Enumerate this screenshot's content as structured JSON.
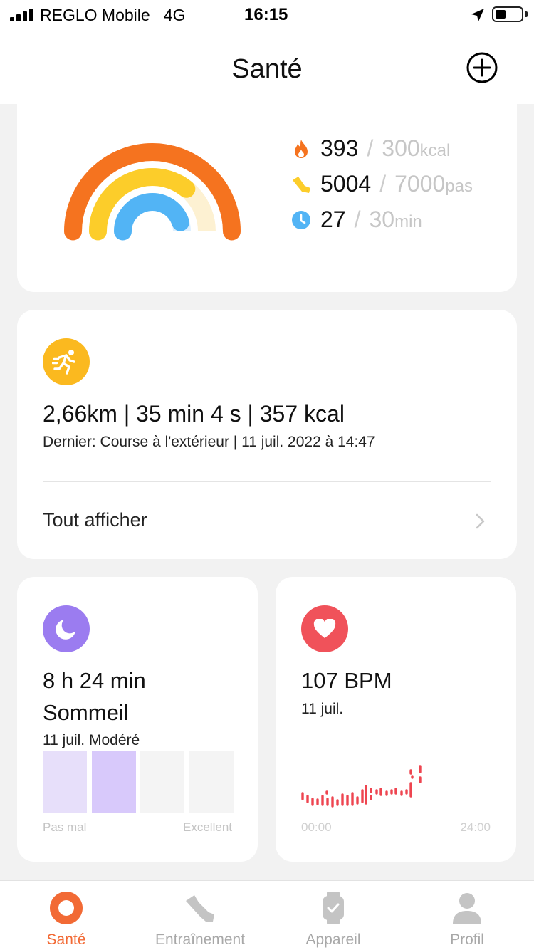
{
  "status_bar": {
    "carrier": "REGLO Mobile",
    "network": "4G",
    "time": "16:15"
  },
  "header": {
    "title": "Santé",
    "add_icon": "plus-circle-icon"
  },
  "activity": {
    "stats": [
      {
        "icon": "flame-icon",
        "value": "393",
        "goal": "300",
        "unit": "kcal",
        "color": "#f5731f",
        "progress": 1.31
      },
      {
        "icon": "steps-icon",
        "value": "5004",
        "goal": "7000",
        "unit": "pas",
        "color": "#fccd2a",
        "progress": 0.715
      },
      {
        "icon": "clock-icon",
        "value": "27",
        "goal": "30",
        "unit": "min",
        "color": "#52b4f5",
        "progress": 0.9
      }
    ]
  },
  "workout": {
    "icon": "running-icon",
    "summary": "2,66km | 35 min 4 s | 357 kcal",
    "last": "Dernier: Course à l'extérieur | 11 juil. 2022 à 14:47",
    "view_all": "Tout afficher"
  },
  "sleep": {
    "icon": "moon-icon",
    "duration": "8 h 24 min",
    "label": "Sommeil",
    "date": "11 juil.",
    "quality": "Modéré",
    "scale_min": "Pas mal",
    "scale_max": "Excellent",
    "quality_level": 2,
    "levels": 4
  },
  "heart": {
    "icon": "heart-icon",
    "bpm": "107 BPM",
    "date": "11 juil.",
    "x_start": "00:00",
    "x_end": "24:00",
    "color": "#ee4550"
  },
  "tabs": [
    {
      "label": "Santé",
      "icon": "health-ring-icon",
      "active": true
    },
    {
      "label": "Entraînement",
      "icon": "shoe-icon",
      "active": false
    },
    {
      "label": "Appareil",
      "icon": "watch-icon",
      "active": false
    },
    {
      "label": "Profil",
      "icon": "person-icon",
      "active": false
    }
  ]
}
